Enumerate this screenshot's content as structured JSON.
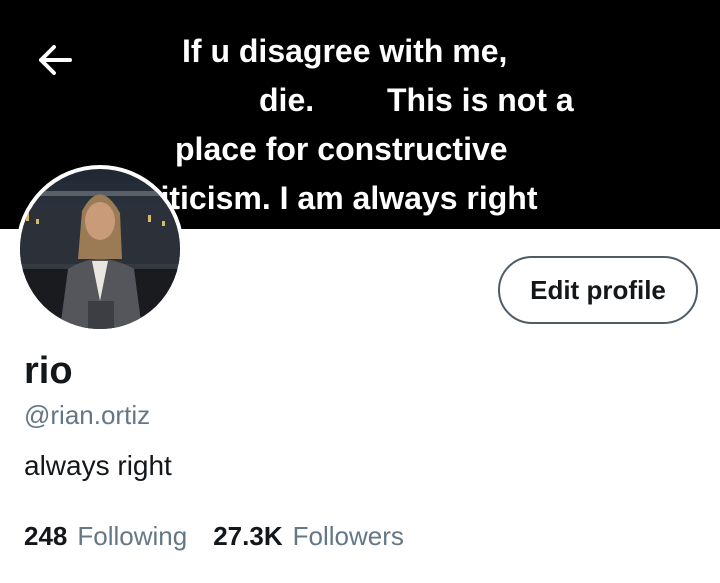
{
  "header": {
    "back_icon": "arrow-left-icon",
    "banner_text": {
      "line1": "If u disagree with me,",
      "line2a": "die.",
      "line2b": "This is not a",
      "line3": "place for constructive",
      "line4": "riticism. I am always right"
    }
  },
  "profile": {
    "avatar_icon": "profile-photo",
    "edit_label": "Edit profile",
    "display_name": "rio",
    "handle": "@rian.ortiz",
    "bio": "always right",
    "following_count": "248",
    "following_label": "Following",
    "followers_count": "27.3K",
    "followers_label": "Followers"
  },
  "colors": {
    "text_primary": "#14171a",
    "text_secondary": "#657786",
    "banner_bg": "#000000"
  }
}
